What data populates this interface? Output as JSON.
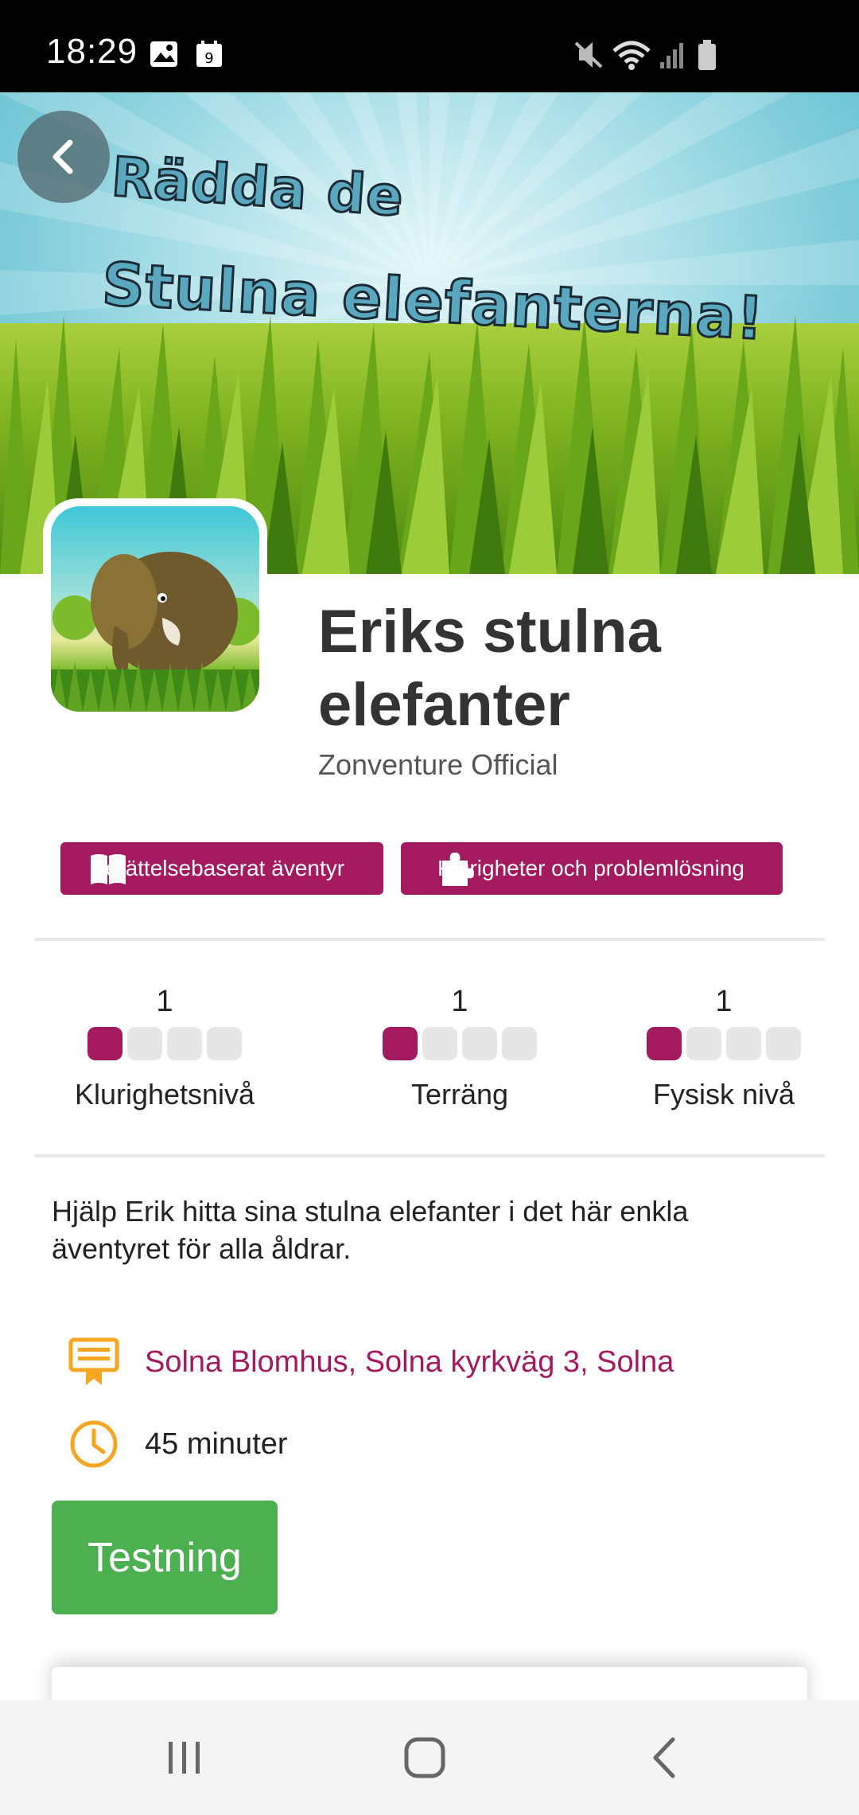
{
  "status_bar": {
    "time": "18:29",
    "icons": [
      "image-icon",
      "calendar-icon",
      "mute-icon",
      "wifi-icon",
      "signal-icon",
      "battery-icon"
    ]
  },
  "hero": {
    "title_line1": "Rädda de",
    "title_line2": "Stulna elefanterna!"
  },
  "adventure": {
    "title": "Eriks stulna elefanter",
    "author": "Zonventure Official"
  },
  "tags": [
    {
      "label": "Berättelsebaserat äventyr",
      "icon": "book-icon"
    },
    {
      "label": "Klurigheter och problemlösning",
      "icon": "puzzle-icon"
    }
  ],
  "stats": [
    {
      "value": "1",
      "level": 1,
      "max": 4,
      "label": "Klurighetsnivå"
    },
    {
      "value": "1",
      "level": 1,
      "max": 4,
      "label": "Terräng"
    },
    {
      "value": "1",
      "level": 1,
      "max": 4,
      "label": "Fysisk nivå"
    }
  ],
  "description": "Hjälp Erik hitta sina stulna elefanter i det här enkla äventyret för alla åldrar.",
  "location": "Solna Blomhus, Solna kyrkväg 3, Solna",
  "duration": "45 minuter",
  "primary_button": "Testning",
  "colors": {
    "accent": "#a31a5e",
    "button_green": "#4caf50",
    "icon_orange": "#f5a623"
  },
  "nav": [
    "recents-icon",
    "home-icon",
    "back-nav-icon"
  ]
}
